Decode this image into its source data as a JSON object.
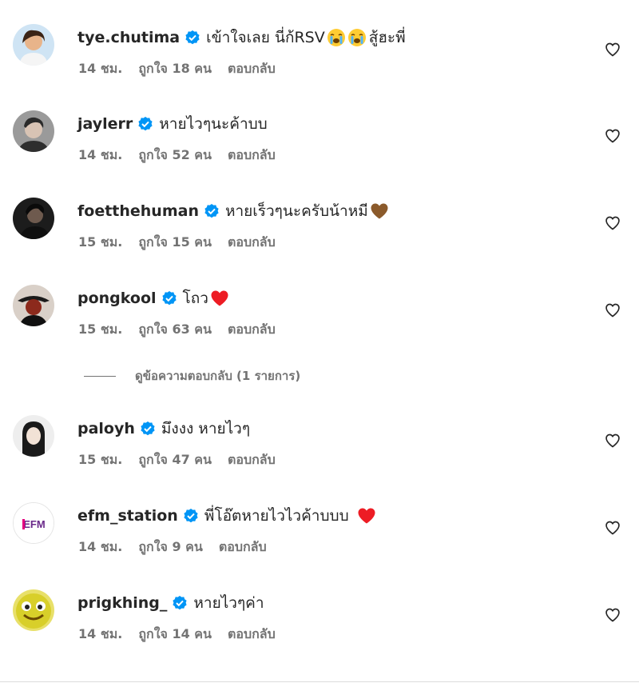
{
  "comments": [
    {
      "username": "tye.chutima",
      "text": "เข้าใจเลย นี่ก้RSV",
      "emojis_before": [
        "loudly-crying-face-emoji",
        "loudly-crying-face-emoji"
      ],
      "text_after": "สู้ฮะพี่",
      "time": "14 ชม.",
      "likes": "ถูกใจ 18 คน",
      "reply": "ตอบกลับ"
    },
    {
      "username": "jaylerr",
      "text": "หายไวๆนะค้าบบ",
      "time": "14 ชม.",
      "likes": "ถูกใจ 52 คน",
      "reply": "ตอบกลับ"
    },
    {
      "username": "foetthehuman",
      "text": "หายเร็วๆนะครับน้าหมี",
      "emoji": "brown-heart-emoji",
      "time": "15 ชม.",
      "likes": "ถูกใจ 15 คน",
      "reply": "ตอบกลับ"
    },
    {
      "username": "pongkool",
      "text": "โถว",
      "emoji": "red-heart-emoji",
      "time": "15 ชม.",
      "likes": "ถูกใจ 63 คน",
      "reply": "ตอบกลับ"
    },
    {
      "username": "paloyh",
      "text": "มึงงง หายไวๆ",
      "time": "15 ชม.",
      "likes": "ถูกใจ 47 คน",
      "reply": "ตอบกลับ"
    },
    {
      "username": "efm_station",
      "text": "พี่โอ๊ตหายไวไวค้าบบบ",
      "emoji": "red-heart-emoji",
      "time": "14 ชม.",
      "likes": "ถูกใจ 9 คน",
      "reply": "ตอบกลับ"
    },
    {
      "username": "prigkhing_",
      "text": "หายไวๆค่า",
      "time": "14 ชม.",
      "likes": "ถูกใจ 14 คน",
      "reply": "ตอบกลับ"
    }
  ],
  "view_replies": "ดูข้อความตอบกลับ (1 รายการ)",
  "avatar_logo_text": "EFM",
  "colors": {
    "verified": "#0095f6",
    "meta": "#737373",
    "heart_red": "#ed1c24",
    "heart_brown": "#8b5a2b"
  }
}
